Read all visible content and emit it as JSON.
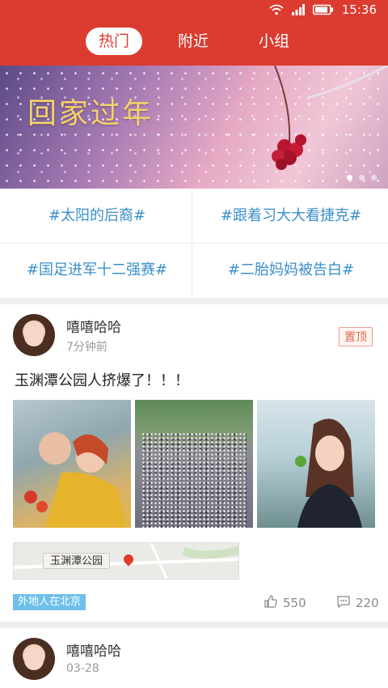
{
  "status_bar": {
    "time": "15:36"
  },
  "tabs": [
    {
      "label": "热门",
      "active": true
    },
    {
      "label": "附近",
      "active": false
    },
    {
      "label": "小组",
      "active": false
    }
  ],
  "banner": {
    "text": "回家过年",
    "slides_total": 3,
    "active_slide": 1
  },
  "topics": [
    "#太阳的后裔#",
    "#跟着习大大看捷克#",
    "#国足进军十二强赛#",
    "#二胎妈妈被告白#"
  ],
  "posts": [
    {
      "username": "嘻嘻哈哈",
      "time": "7分钟前",
      "pinned_label": "置顶",
      "text": "玉渊潭公园人挤爆了！！！",
      "location": "玉渊潭公园",
      "tag": "外地人在北京",
      "likes": "550",
      "comments": "220"
    },
    {
      "username": "嘻嘻哈哈",
      "time": "03-28"
    }
  ],
  "icons": {
    "wifi": "wifi-icon",
    "signal": "signal-icon",
    "battery": "battery-icon",
    "like": "thumb-up-icon",
    "comment": "comment-icon",
    "location": "location-pin-icon"
  },
  "colors": {
    "header": "#dc3b30",
    "topic_text": "#3a8fc9",
    "tag_bg": "#6ec0ea",
    "pin_badge": "#e06a52"
  }
}
